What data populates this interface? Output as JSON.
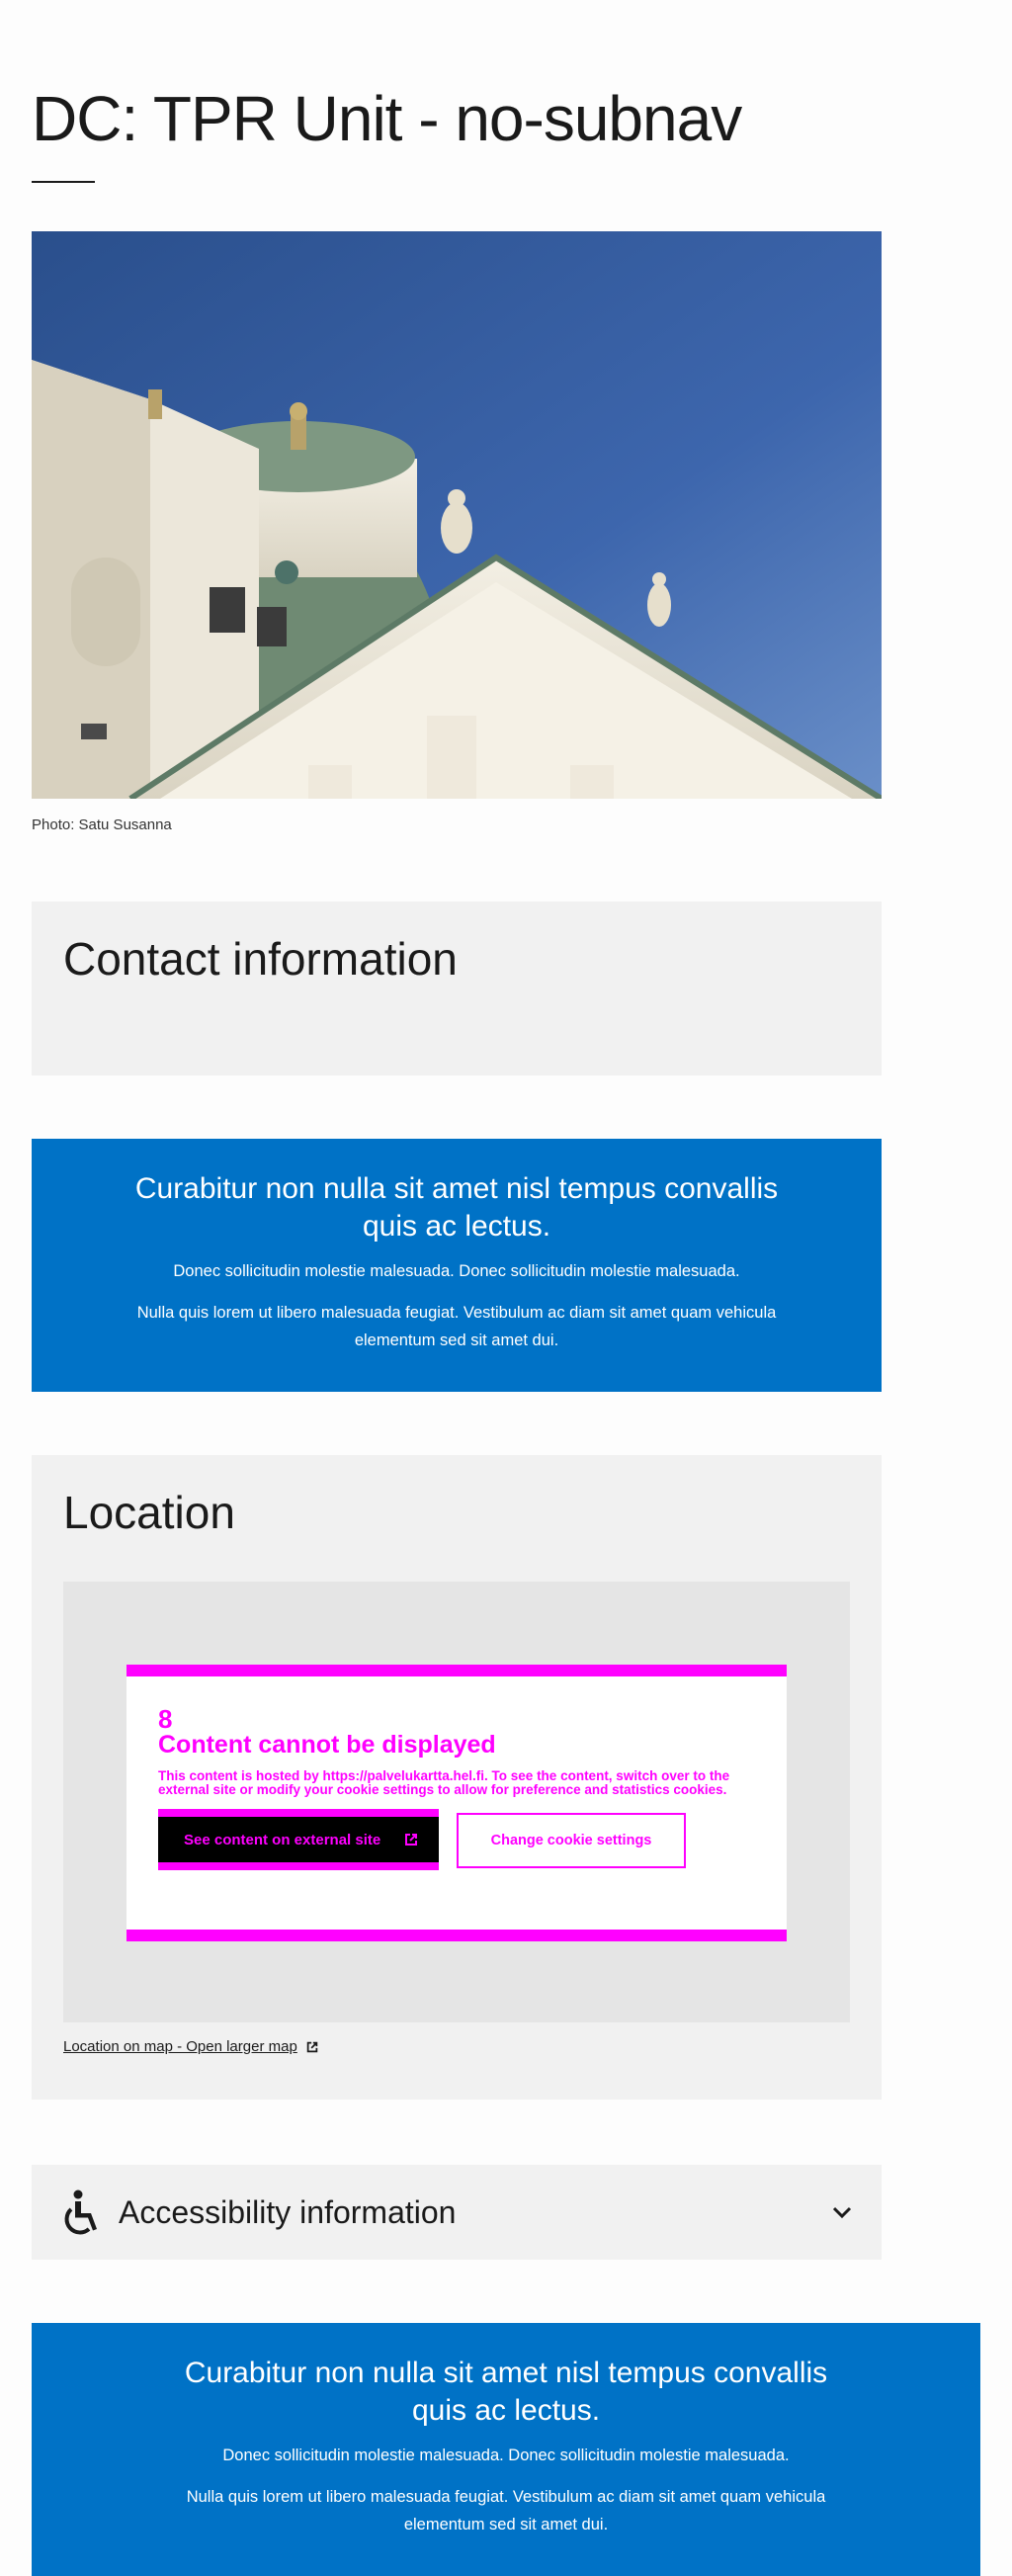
{
  "page": {
    "title": "DC: TPR Unit - no-subnav"
  },
  "hero": {
    "caption": "Photo: Satu Susanna"
  },
  "contact": {
    "heading": "Contact information"
  },
  "banner_top": {
    "title": "Curabitur non nulla sit amet nisl tempus convallis quis ac lectus.",
    "paragraph1": "Donec sollicitudin molestie malesuada. Donec sollicitudin molestie malesuada.",
    "paragraph2": "Nulla quis lorem ut libero malesuada feugiat. Vestibulum ac diam sit amet quam vehicula elementum sed sit amet dui."
  },
  "location": {
    "heading": "Location",
    "notice": {
      "icon": "8",
      "heading": "Content cannot be displayed",
      "text": "This content is hosted by https://palvelukartta.hel.fi. To see the content, switch over to the external site or modify your cookie settings to allow for preference and statistics cookies.",
      "external_button": "See content on external site",
      "cookie_button": "Change cookie settings"
    },
    "map_link": "Location on map - Open larger map"
  },
  "accessibility": {
    "label": "Accessibility information"
  },
  "banner_bottom": {
    "title": "Curabitur non nulla sit amet nisl tempus convallis quis ac lectus.",
    "paragraph1": "Donec sollicitudin molestie malesuada. Donec sollicitudin molestie malesuada.",
    "paragraph2": "Nulla quis lorem ut libero malesuada feugiat. Vestibulum ac diam sit amet quam vehicula elementum sed sit amet dui."
  },
  "colors": {
    "brand_blue": "#0072c6",
    "panel_gray": "#f1f1f1",
    "notice_magenta": "#ff00ff"
  },
  "icons": {
    "external_link": "external-link-icon",
    "wheelchair": "wheelchair-icon",
    "chevron": "chevron-down-icon"
  }
}
